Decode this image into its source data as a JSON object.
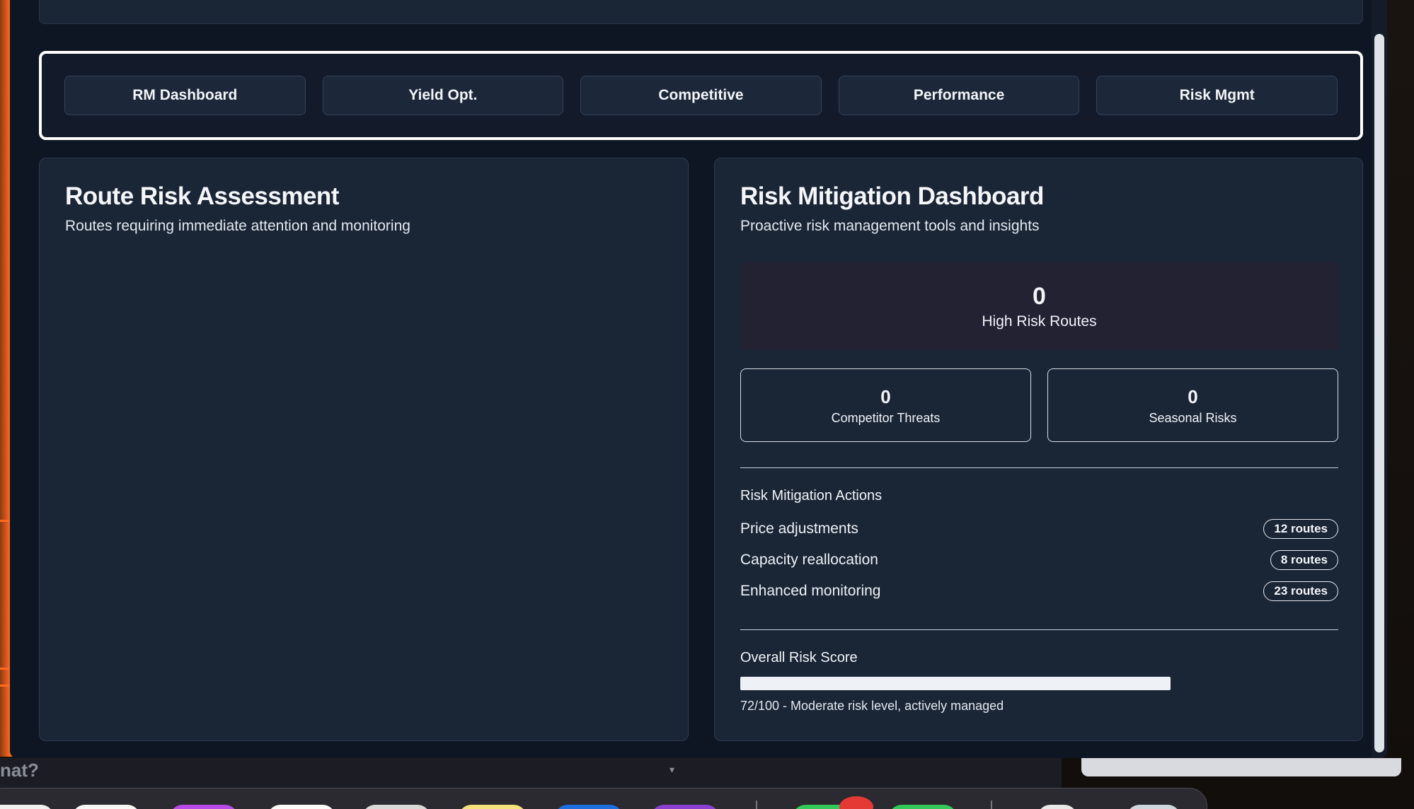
{
  "nav": {
    "items": [
      {
        "label": "RM Dashboard"
      },
      {
        "label": "Yield Opt."
      },
      {
        "label": "Competitive"
      },
      {
        "label": "Performance"
      },
      {
        "label": "Risk Mgmt"
      }
    ]
  },
  "route_risk": {
    "title": "Route Risk Assessment",
    "subtitle": "Routes requiring immediate attention and monitoring"
  },
  "mitigation": {
    "title": "Risk Mitigation Dashboard",
    "subtitle": "Proactive risk management tools and insights",
    "high_risk": {
      "value": "0",
      "label": "High Risk Routes"
    },
    "competitor_threats": {
      "value": "0",
      "label": "Competitor Threats"
    },
    "seasonal_risks": {
      "value": "0",
      "label": "Seasonal Risks"
    },
    "actions_title": "Risk Mitigation Actions",
    "actions": [
      {
        "label": "Price adjustments",
        "badge": "12 routes"
      },
      {
        "label": "Capacity reallocation",
        "badge": "8 routes"
      },
      {
        "label": "Enhanced monitoring",
        "badge": "23 routes"
      }
    ],
    "overall_title": "Overall Risk Score",
    "overall_score": 72,
    "overall_caption": "72/100 - Moderate risk level, actively managed"
  },
  "desktop": {
    "input_partial_text": "nat?"
  },
  "colors": {
    "window_bg": "#0f1623",
    "panel_bg": "#1a2536",
    "accent_orange": "#ff6a1f"
  }
}
